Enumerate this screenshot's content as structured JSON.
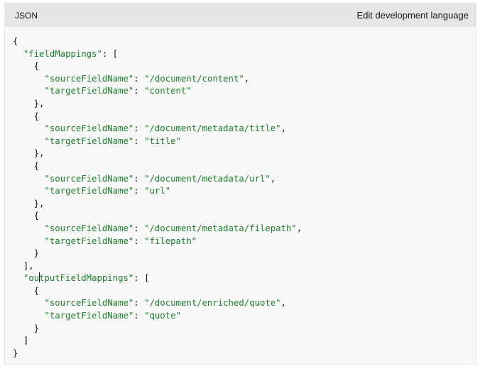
{
  "header": {
    "language_label": "JSON",
    "edit_link": "Edit development language"
  },
  "code": {
    "lines": [
      {
        "indent": "",
        "parts": [
          {
            "t": "p",
            "v": "{"
          }
        ]
      },
      {
        "indent": "  ",
        "parts": [
          {
            "t": "k",
            "v": "\"fieldMappings\""
          },
          {
            "t": "p",
            "v": ": ["
          }
        ]
      },
      {
        "indent": "    ",
        "parts": [
          {
            "t": "p",
            "v": "{"
          }
        ]
      },
      {
        "indent": "      ",
        "parts": [
          {
            "t": "k",
            "v": "\"sourceFieldName\""
          },
          {
            "t": "p",
            "v": ": "
          },
          {
            "t": "s",
            "v": "\"/document/content\""
          },
          {
            "t": "p",
            "v": ","
          }
        ]
      },
      {
        "indent": "      ",
        "parts": [
          {
            "t": "k",
            "v": "\"targetFieldName\""
          },
          {
            "t": "p",
            "v": ": "
          },
          {
            "t": "s",
            "v": "\"content\""
          }
        ]
      },
      {
        "indent": "    ",
        "parts": [
          {
            "t": "p",
            "v": "},"
          }
        ]
      },
      {
        "indent": "    ",
        "parts": [
          {
            "t": "p",
            "v": "{"
          }
        ]
      },
      {
        "indent": "      ",
        "parts": [
          {
            "t": "k",
            "v": "\"sourceFieldName\""
          },
          {
            "t": "p",
            "v": ": "
          },
          {
            "t": "s",
            "v": "\"/document/metadata/title\""
          },
          {
            "t": "p",
            "v": ","
          }
        ]
      },
      {
        "indent": "      ",
        "parts": [
          {
            "t": "k",
            "v": "\"targetFieldName\""
          },
          {
            "t": "p",
            "v": ": "
          },
          {
            "t": "s",
            "v": "\"title\""
          }
        ]
      },
      {
        "indent": "    ",
        "parts": [
          {
            "t": "p",
            "v": "},"
          }
        ]
      },
      {
        "indent": "    ",
        "parts": [
          {
            "t": "p",
            "v": "{"
          }
        ]
      },
      {
        "indent": "      ",
        "parts": [
          {
            "t": "k",
            "v": "\"sourceFieldName\""
          },
          {
            "t": "p",
            "v": ": "
          },
          {
            "t": "s",
            "v": "\"/document/metadata/url\""
          },
          {
            "t": "p",
            "v": ","
          }
        ]
      },
      {
        "indent": "      ",
        "parts": [
          {
            "t": "k",
            "v": "\"targetFieldName\""
          },
          {
            "t": "p",
            "v": ": "
          },
          {
            "t": "s",
            "v": "\"url\""
          }
        ]
      },
      {
        "indent": "    ",
        "parts": [
          {
            "t": "p",
            "v": "},"
          }
        ]
      },
      {
        "indent": "    ",
        "parts": [
          {
            "t": "p",
            "v": "{"
          }
        ]
      },
      {
        "indent": "      ",
        "parts": [
          {
            "t": "k",
            "v": "\"sourceFieldName\""
          },
          {
            "t": "p",
            "v": ": "
          },
          {
            "t": "s",
            "v": "\"/document/metadata/filepath\""
          },
          {
            "t": "p",
            "v": ","
          }
        ]
      },
      {
        "indent": "      ",
        "parts": [
          {
            "t": "k",
            "v": "\"targetFieldName\""
          },
          {
            "t": "p",
            "v": ": "
          },
          {
            "t": "s",
            "v": "\"filepath\""
          }
        ]
      },
      {
        "indent": "    ",
        "parts": [
          {
            "t": "p",
            "v": "}"
          }
        ]
      },
      {
        "indent": "  ",
        "parts": [
          {
            "t": "p",
            "v": "],"
          }
        ]
      },
      {
        "indent": "  ",
        "parts": [
          {
            "t": "k",
            "v": "\"outputFieldMappings\""
          },
          {
            "t": "p",
            "v": ": ["
          }
        ]
      },
      {
        "indent": "    ",
        "parts": [
          {
            "t": "p",
            "v": "{"
          }
        ]
      },
      {
        "indent": "      ",
        "parts": [
          {
            "t": "k",
            "v": "\"sourceFieldName\""
          },
          {
            "t": "p",
            "v": ": "
          },
          {
            "t": "s",
            "v": "\"/document/enriched/quote\""
          },
          {
            "t": "p",
            "v": ","
          }
        ]
      },
      {
        "indent": "      ",
        "parts": [
          {
            "t": "k",
            "v": "\"targetFieldName\""
          },
          {
            "t": "p",
            "v": ": "
          },
          {
            "t": "s",
            "v": "\"quote\""
          }
        ]
      },
      {
        "indent": "    ",
        "parts": [
          {
            "t": "p",
            "v": "}"
          }
        ]
      },
      {
        "indent": "  ",
        "parts": [
          {
            "t": "p",
            "v": "]"
          }
        ]
      },
      {
        "indent": "",
        "parts": [
          {
            "t": "p",
            "v": "}"
          }
        ]
      }
    ]
  },
  "colors": {
    "key": "#1b7f2a",
    "string": "#1b7f2a",
    "punctuation": "#171717",
    "header_bg": "#e6e6e6",
    "code_bg": "#f8f8f8"
  }
}
